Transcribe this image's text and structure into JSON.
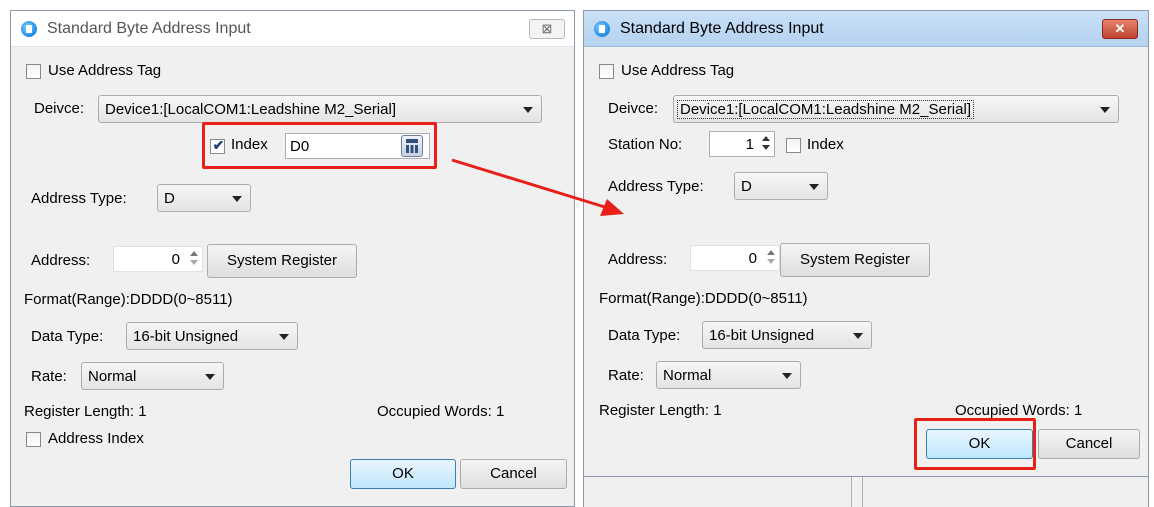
{
  "left_dialog": {
    "title": "Standard Byte Address Input",
    "close_symbol": "⊠",
    "use_address_tag_label": "Use Address Tag",
    "device_label": "Deivce:",
    "device_value": "Device1:[LocalCOM1:Leadshine M2_Serial]",
    "index_label": "Index",
    "index_value": "D0",
    "address_type_label": "Address Type:",
    "address_type_value": "D",
    "address_label": "Address:",
    "address_value": "0",
    "system_register_label": "System Register",
    "format_text": "Format(Range):DDDD(0~8511)",
    "data_type_label": "Data Type:",
    "data_type_value": "16-bit Unsigned",
    "rate_label": "Rate:",
    "rate_value": "Normal",
    "register_length_text": "Register Length: 1",
    "occupied_words_text": "Occupied Words: 1",
    "address_index_label": "Address Index",
    "ok_label": "OK",
    "cancel_label": "Cancel"
  },
  "right_dialog": {
    "title": "Standard Byte Address Input",
    "close_symbol": "✕",
    "use_address_tag_label": "Use Address Tag",
    "device_label": "Deivce:",
    "device_value": "Device1:[LocalCOM1:Leadshine M2_Serial]",
    "station_no_label": "Station No:",
    "station_no_value": "1",
    "index_label": "Index",
    "address_type_label": "Address Type:",
    "address_type_value": "D",
    "address_label": "Address:",
    "address_value": "0",
    "system_register_label": "System Register",
    "format_text": "Format(Range):DDDD(0~8511)",
    "data_type_label": "Data Type:",
    "data_type_value": "16-bit Unsigned",
    "rate_label": "Rate:",
    "rate_value": "Normal",
    "register_length_text": "Register Length: 1",
    "occupied_words_text": "Occupied Words: 1",
    "ok_label": "OK",
    "cancel_label": "Cancel"
  },
  "annotation": {
    "highlight_color": "#e8201a",
    "arrow_color": "#e8201a"
  }
}
